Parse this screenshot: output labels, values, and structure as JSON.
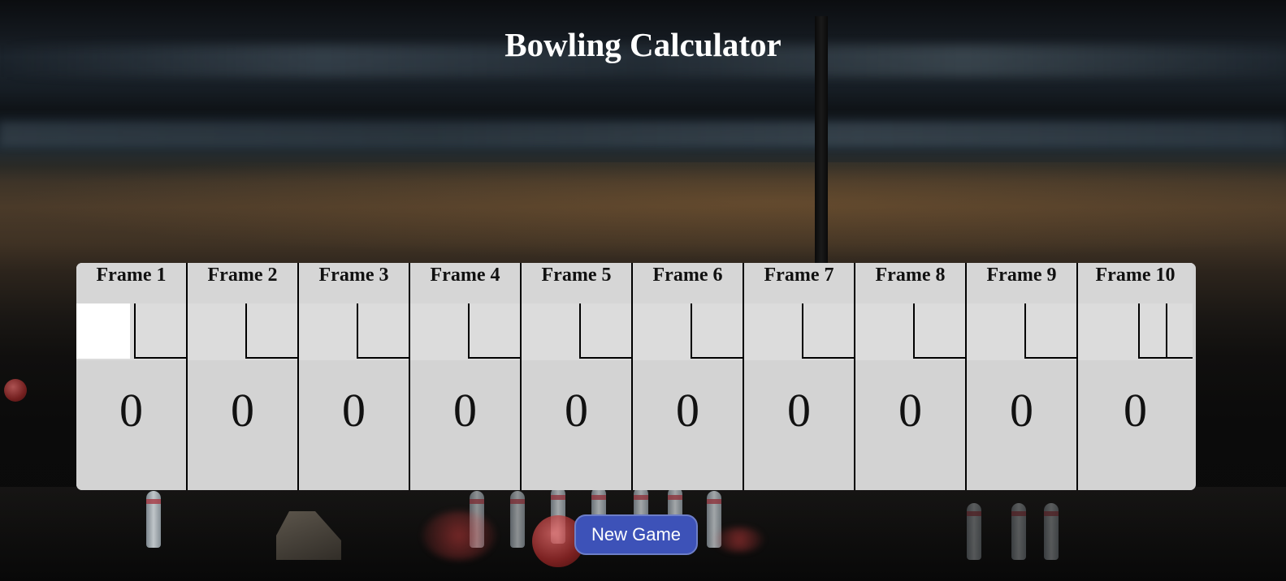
{
  "page": {
    "title": "Bowling Calculator"
  },
  "frames": [
    {
      "label": "Frame 1",
      "score": "0"
    },
    {
      "label": "Frame 2",
      "score": "0"
    },
    {
      "label": "Frame 3",
      "score": "0"
    },
    {
      "label": "Frame 4",
      "score": "0"
    },
    {
      "label": "Frame 5",
      "score": "0"
    },
    {
      "label": "Frame 6",
      "score": "0"
    },
    {
      "label": "Frame 7",
      "score": "0"
    },
    {
      "label": "Frame 8",
      "score": "0"
    },
    {
      "label": "Frame 9",
      "score": "0"
    },
    {
      "label": "Frame 10",
      "score": "0"
    }
  ],
  "actions": {
    "new_game_label": "New Game"
  },
  "colors": {
    "title_text": "#ffffff",
    "scoreboard_bg": "#d3d3d3",
    "active_roll": "#ffffff",
    "button_bg": "#3d52b8",
    "button_text": "#ffffff"
  }
}
